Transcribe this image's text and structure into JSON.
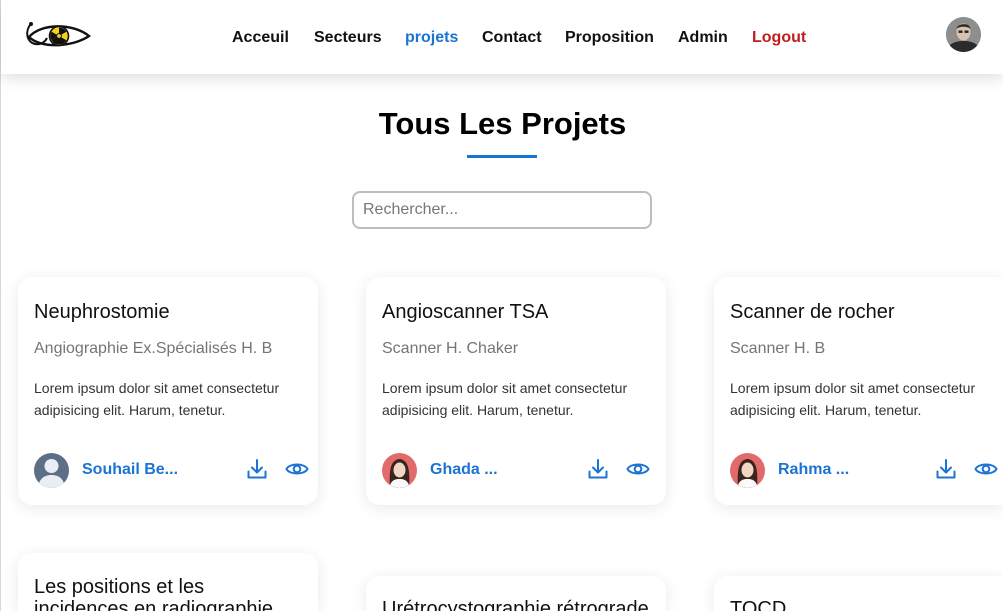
{
  "nav": {
    "links": [
      {
        "label": "Acceuil"
      },
      {
        "label": "Secteurs"
      },
      {
        "label": "projets"
      },
      {
        "label": "Contact"
      },
      {
        "label": "Proposition"
      },
      {
        "label": "Admin"
      },
      {
        "label": "Logout"
      }
    ],
    "active_link": "projets"
  },
  "page": {
    "title": "Tous Les Projets",
    "search_placeholder": "Rechercher..."
  },
  "colors": {
    "accent": "#1b74d3",
    "logout": "#c21c1c",
    "logo_yellow": "#f2d416"
  },
  "projects": [
    {
      "title": "Neuphrostomie",
      "subtitle": "Angiographie Ex.Spécialisés H. B",
      "description": "Lorem ipsum dolor sit amet consectetur adipisicing elit. Harum, tenetur.",
      "author": "Souhail Be...",
      "avatar": "male-avatar"
    },
    {
      "title": "Angioscanner TSA",
      "subtitle": "Scanner H. Chaker",
      "description": "Lorem ipsum dolor sit amet consectetur adipisicing elit. Harum, tenetur.",
      "author": "Ghada ...",
      "avatar": "female-avatar"
    },
    {
      "title": "Scanner de rocher",
      "subtitle": "Scanner H. B",
      "description": "Lorem ipsum dolor sit amet consectetur adipisicing elit. Harum, tenetur.",
      "author": "Rahma ...",
      "avatar": "female-avatar"
    },
    {
      "title": "Les positions et les incidences en radiographie"
    },
    {
      "title": "Urétrocystographie rétrograde"
    },
    {
      "title": "TOCD"
    }
  ],
  "icons": {
    "download": "download-icon",
    "view": "eye-icon"
  }
}
